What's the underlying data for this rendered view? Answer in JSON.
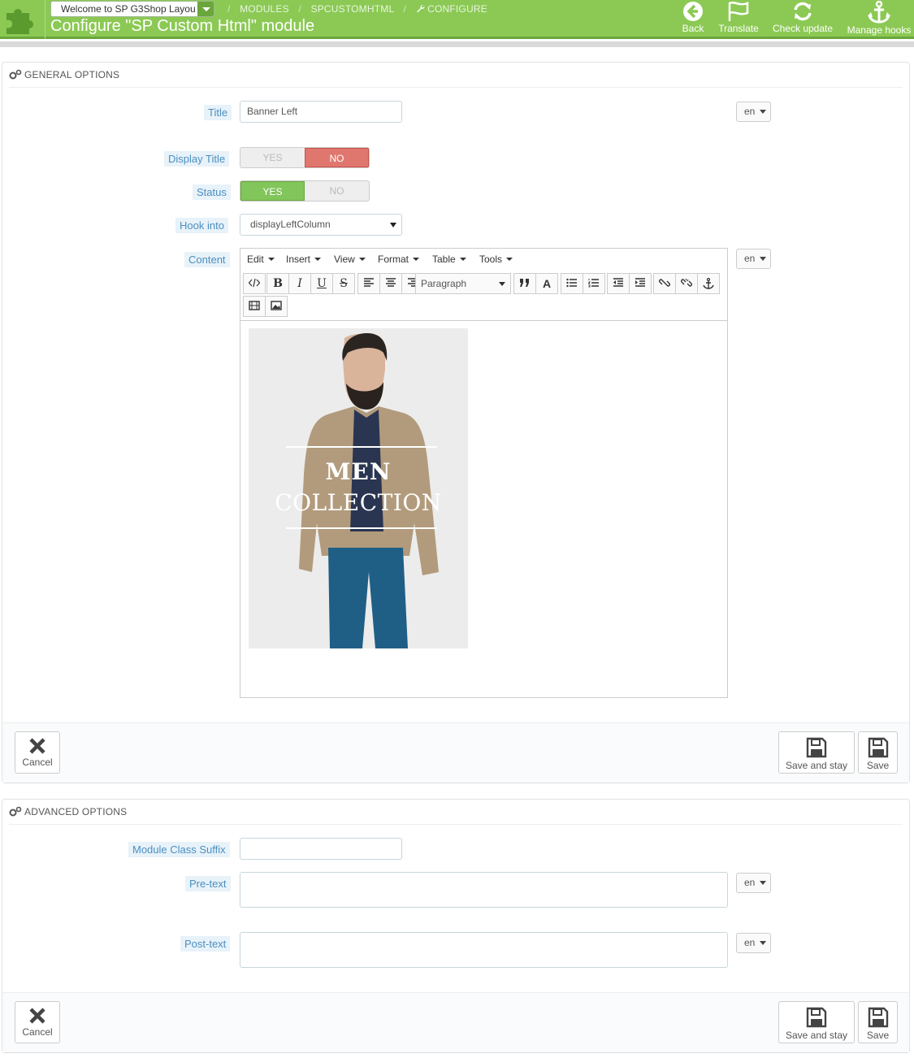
{
  "header": {
    "shop_select": "Welcome to SP G3Shop Layou",
    "breadcrumbs": [
      "MODULES",
      "SPCUSTOMHTML",
      "CONFIGURE"
    ],
    "page_title": "Configure \"SP Custom Html\" module",
    "actions": [
      {
        "label": "Back",
        "icon": "arrow-left-circle-icon"
      },
      {
        "label": "Translate",
        "icon": "flag-icon"
      },
      {
        "label": "Check update",
        "icon": "refresh-icon"
      },
      {
        "label": "Manage hooks",
        "icon": "anchor-icon"
      }
    ],
    "accent": "#8bc954"
  },
  "general": {
    "heading": "GENERAL OPTIONS",
    "title_label": "Title",
    "title_value": "Banner Left",
    "lang": "en",
    "display_title_label": "Display Title",
    "display_title": {
      "yes": "YES",
      "no": "NO",
      "selected": "NO"
    },
    "status_label": "Status",
    "status": {
      "yes": "YES",
      "no": "NO",
      "selected": "YES"
    },
    "hook_label": "Hook into",
    "hook_value": "displayLeftColumn",
    "content_label": "Content",
    "editor": {
      "menus": [
        "Edit",
        "Insert",
        "View",
        "Format",
        "Table",
        "Tools"
      ],
      "format_select": "Paragraph",
      "banner_line1": "MEN",
      "banner_line2": "COLLECTION"
    }
  },
  "advanced": {
    "heading": "ADVANCED OPTIONS",
    "suffix_label": "Module Class Suffix",
    "suffix_value": "",
    "pretext_label": "Pre-text",
    "posttext_label": "Post-text",
    "lang": "en"
  },
  "footer": {
    "cancel": "Cancel",
    "save_stay": "Save and stay",
    "save": "Save"
  }
}
